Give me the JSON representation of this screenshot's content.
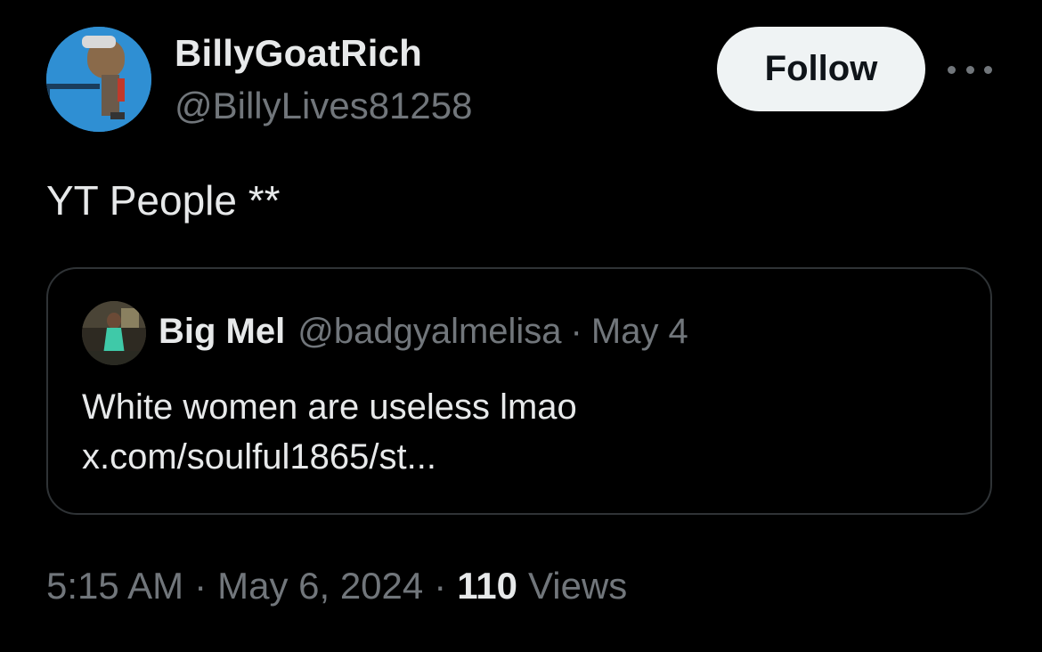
{
  "author": {
    "name": "BillyGoatRich",
    "handle": "@BillyLives81258"
  },
  "actions": {
    "follow_label": "Follow"
  },
  "tweet": {
    "text": "YT People **"
  },
  "quoted_tweet": {
    "name": "Big Mel",
    "handle": "@badgyalmelisa",
    "separator": "·",
    "date": "May 4",
    "text": "White women are useless lmao",
    "link": "x.com/soulful1865/st..."
  },
  "footer": {
    "time": "5:15 AM",
    "separator": "·",
    "date": "May 6, 2024",
    "views_count": "110",
    "views_label": "Views"
  },
  "icons": {
    "more": "more-horizontal-icon"
  },
  "colors": {
    "background": "#000000",
    "primary_text": "#e7e9ea",
    "secondary_text": "#71767b",
    "border": "#2f3336",
    "follow_bg": "#eff3f4",
    "follow_text": "#0f1419"
  }
}
